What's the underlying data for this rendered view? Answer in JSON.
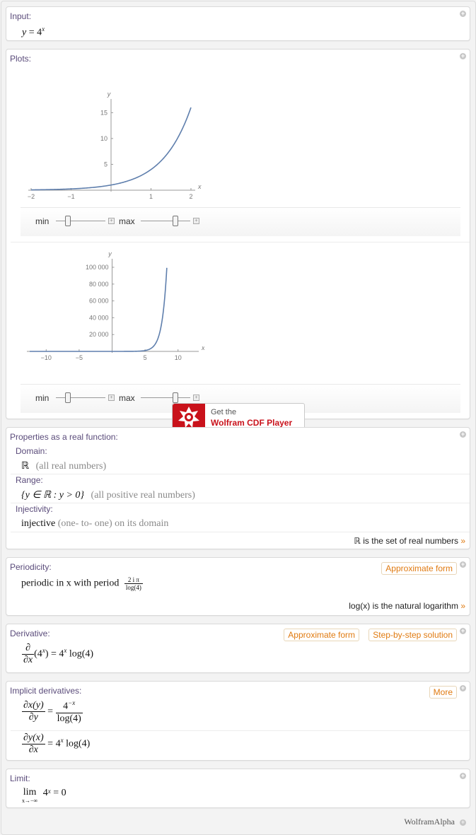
{
  "input_pod": {
    "title": "Input:",
    "expr_y": "y",
    "expr_eq": " = 4",
    "expr_sup": "x"
  },
  "plots_pod": {
    "title": "Plots:",
    "slider_min_label": "min",
    "slider_max_label": "max"
  },
  "chart_data": [
    {
      "type": "line",
      "title": "",
      "xlabel": "x",
      "ylabel": "y",
      "xlim": [
        -2,
        2
      ],
      "ylim": [
        0,
        16
      ],
      "x_ticks": [
        "−2",
        "−1",
        "1",
        "2"
      ],
      "y_ticks": [
        "5",
        "10",
        "15"
      ],
      "series": [
        {
          "x": [
            -2,
            -1.5,
            -1,
            -0.5,
            0,
            0.5,
            1,
            1.5,
            2
          ],
          "values": [
            0.0625,
            0.125,
            0.25,
            0.5,
            1,
            2,
            4,
            8,
            16
          ]
        }
      ],
      "color": "#5f7fad"
    },
    {
      "type": "line",
      "title": "",
      "xlabel": "x",
      "ylabel": "y",
      "xlim": [
        -12.5,
        12.5
      ],
      "ylim": [
        0,
        100000
      ],
      "x_ticks": [
        "−10",
        "−5",
        "5",
        "10"
      ],
      "y_ticks": [
        "20 000",
        "40 000",
        "60 000",
        "80 000",
        "100 000"
      ],
      "series": [
        {
          "x": [
            0,
            2,
            4,
            5,
            6,
            7,
            7.5,
            8,
            8.3
          ],
          "values": [
            1,
            16,
            256,
            1024,
            4096,
            16384,
            32768,
            65536,
            99000
          ]
        }
      ],
      "color": "#5f7fad"
    }
  ],
  "cdf": {
    "line1": "Get the",
    "line2": "Wolfram CDF Player"
  },
  "properties_pod": {
    "title": "Properties as a real function:",
    "domain_label": "Domain:",
    "domain_value": "ℝ",
    "domain_note": "(all real numbers)",
    "range_label": "Range:",
    "range_value": "{y ∈ ℝ : y > 0}",
    "range_note": "(all positive real numbers)",
    "injectivity_label": "Injectivity:",
    "injectivity_value": "injective",
    "injectivity_note": "(one- to- one)",
    "injectivity_tail": "on its domain",
    "footnote": "ℝ is the set of real numbers",
    "footnote_arrow": "»"
  },
  "periodicity_pod": {
    "title": "Periodicity:",
    "button": "Approximate form",
    "text": "periodic in x with period",
    "frac_num": "2 i π",
    "frac_den": "log(4)",
    "footnote": "log(x) is the natural logarithm",
    "footnote_arrow": "»"
  },
  "derivative_pod": {
    "title": "Derivative:",
    "button1": "Approximate form",
    "button2": "Step-by-step solution",
    "num": "∂",
    "den": "∂x",
    "expr": "(4",
    "expr_sup": "x",
    "expr_tail": ") = 4",
    "result_sup": "x",
    "result_tail": " log(4)"
  },
  "implicit_pod": {
    "title": "Implicit derivatives:",
    "button": "More",
    "d1_num": "∂x(y)",
    "d1_den": "∂y",
    "d1_rnum": "4",
    "d1_rnum_sup": "−x",
    "d1_rden": "log(4)",
    "d2_num": "∂y(x)",
    "d2_den": "∂x",
    "d2_rhs": "= 4",
    "d2_rhs_sup": "x",
    "d2_tail": " log(4)"
  },
  "limit_pod": {
    "title": "Limit:",
    "lim": "lim",
    "sub": "x→−∞",
    "expr": "4",
    "expr_sup": "x",
    "tail": " = 0"
  },
  "footer": "WolframAlpha"
}
